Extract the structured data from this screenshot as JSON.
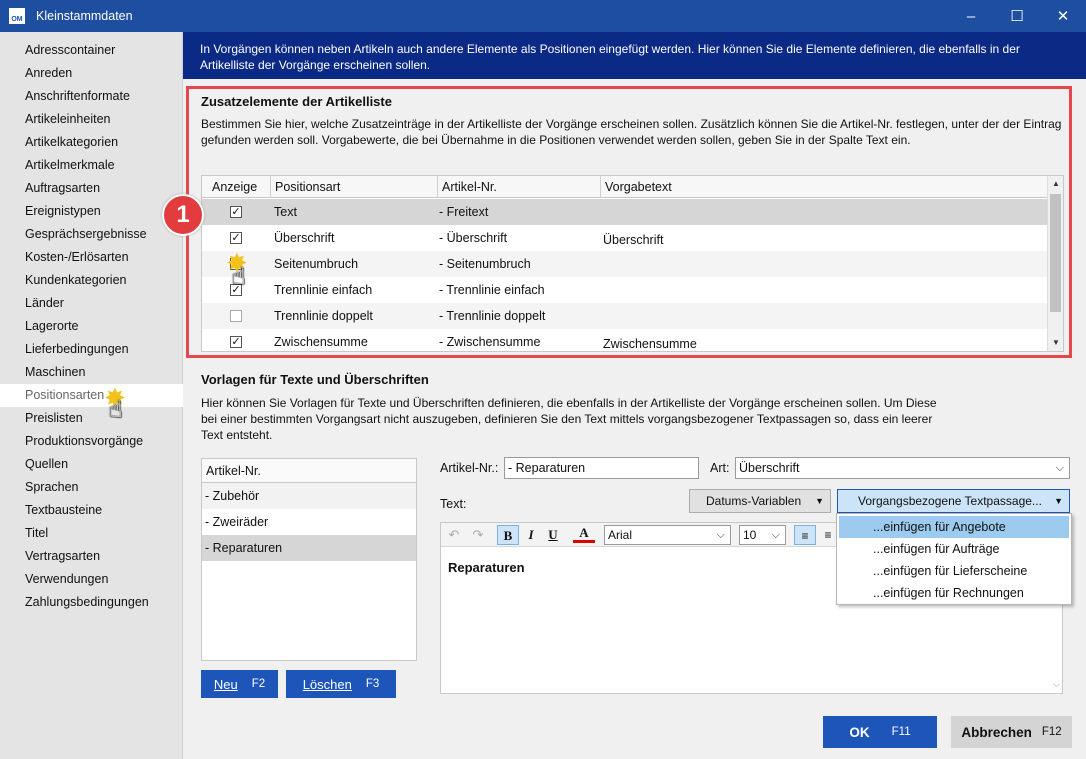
{
  "window": {
    "title": "Kleinstammdaten",
    "logo": "OM",
    "minimize": "–",
    "maximize": "☐",
    "close": "✕"
  },
  "sidebar": {
    "items": [
      "Adresscontainer",
      "Anreden",
      "Anschriftenformate",
      "Artikeleinheiten",
      "Artikelkategorien",
      "Artikelmerkmale",
      "Auftragsarten",
      "Ereignistypen",
      "Gesprächsergebnisse",
      "Kosten-/Erlösarten",
      "Kundenkategorien",
      "Länder",
      "Lagerorte",
      "Lieferbedingungen",
      "Maschinen",
      "Positionsarten",
      "Preislisten",
      "Produktionsvorgänge",
      "Quellen",
      "Sprachen",
      "Textbausteine",
      "Titel",
      "Vertragsarten",
      "Verwendungen",
      "Zahlungsbedingungen"
    ],
    "active_index": 15
  },
  "banner": {
    "line1": "In Vorgängen können neben Artikeln auch andere Elemente als Positionen eingefügt werden. Hier können Sie die Elemente definieren, die ebenfalls in der",
    "line2": "Artikelliste der Vorgänge erscheinen sollen."
  },
  "zusatz": {
    "title": "Zusatzelemente der Artikelliste",
    "desc1": "Bestimmen Sie hier, welche Zusatzeinträge in der Artikelliste der Vorgänge erscheinen sollen. Zusätzlich können Sie die Artikel-Nr. festlegen, unter der der Eintrag",
    "desc2": "gefunden werden soll. Vorgabewerte, die bei Übernahme in die Positionen verwendet werden sollen, geben Sie in der Spalte Text ein.",
    "columns": [
      "Anzeige",
      "Positionsart",
      "Artikel-Nr.",
      "Vorgabetext"
    ],
    "rows": [
      {
        "checked": true,
        "positionsart": "Text",
        "artikel": "- Freitext",
        "vorgabe": ""
      },
      {
        "checked": true,
        "positionsart": "Überschrift",
        "artikel": "- Überschrift",
        "vorgabe": "Überschrift"
      },
      {
        "checked": true,
        "positionsart": "Seitenumbruch",
        "artikel": "- Seitenumbruch",
        "vorgabe": ""
      },
      {
        "checked": true,
        "positionsart": "Trennlinie einfach",
        "artikel": "- Trennlinie einfach",
        "vorgabe": ""
      },
      {
        "checked": false,
        "positionsart": "Trennlinie doppelt",
        "artikel": "- Trennlinie doppelt",
        "vorgabe": ""
      },
      {
        "checked": true,
        "positionsart": "Zwischensumme",
        "artikel": "- Zwischensumme",
        "vorgabe": "Zwischensumme"
      }
    ],
    "check_mark": "✓",
    "badge": "1"
  },
  "vorlagen": {
    "title": "Vorlagen für Texte und Überschriften",
    "desc1": "Hier können Sie Vorlagen für Texte und Überschriften definieren, die ebenfalls in der Artikelliste der Vorgänge erscheinen sollen. Um Diese",
    "desc2": "bei einer bestimmten Vorgangsart nicht auszugeben, definieren Sie den Text mittels vorgangsbezogener Textpassagen so, dass ein leerer",
    "desc3": "Text entsteht.",
    "list_header": "Artikel-Nr.",
    "list_items": [
      "- Zubehör",
      "- Zweiräder",
      "- Reparaturen"
    ],
    "artikel_label": "Artikel-Nr.:",
    "artikel_value": "- Reparaturen",
    "art_label": "Art:",
    "art_value": "Überschrift",
    "text_label": "Text:",
    "datums_button": "Datums-Variablen",
    "vorgang_button": "Vorgangsbezogene Textpassage...",
    "font": "Arial",
    "size": "10",
    "editor_text": "Reparaturen",
    "menu": [
      "...einfügen für Angebote",
      "...einfügen für Aufträge",
      "...einfügen für Lieferscheine",
      "...einfügen für Rechnungen"
    ]
  },
  "buttons": {
    "neu": "Neu",
    "neu_key": "F2",
    "loeschen": "Löschen",
    "loeschen_key": "F3",
    "ok": "OK",
    "ok_key": "F11",
    "cancel": "Abbrechen",
    "cancel_key": "F12"
  }
}
